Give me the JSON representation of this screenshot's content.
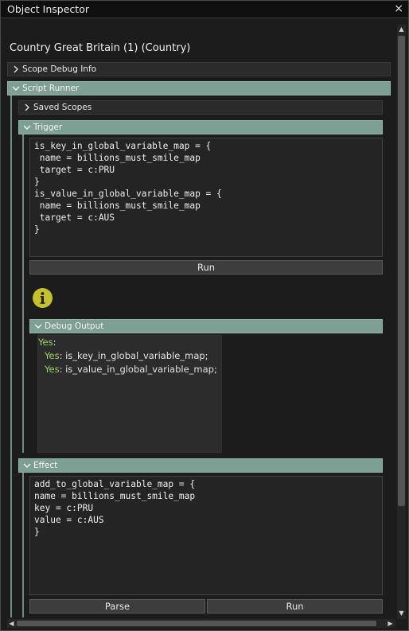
{
  "window": {
    "title": "Object Inspector",
    "close_glyph": "×"
  },
  "object_name": "Country Great Britain (1) (Country)",
  "sections": {
    "scope_debug_info": "Scope Debug Info",
    "script_runner": "Script Runner",
    "saved_scopes": "Saved Scopes",
    "trigger": "Trigger",
    "debug_output": "Debug Output",
    "effect": "Effect"
  },
  "trigger_script": "is_key_in_global_variable_map = {\n name = billions_must_smile_map\n target = c:PRU\n}\nis_value_in_global_variable_map = {\n name = billions_must_smile_map\n target = c:AUS\n}",
  "trigger_run_label": "Run",
  "debug_output": {
    "root_yes": "Yes",
    "root_colon": ":",
    "lines": [
      {
        "yes": "Yes",
        "text": ": is_key_in_global_variable_map;"
      },
      {
        "yes": "Yes",
        "text": ": is_value_in_global_variable_map;"
      }
    ]
  },
  "effect_script": "add_to_global_variable_map = {\nname = billions_must_smile_map\nkey = c:PRU\nvalue = c:AUS\n}",
  "effect_parse_label": "Parse",
  "effect_run_label": "Run",
  "icons": [
    "close-icon",
    "chevron-right-icon",
    "chevron-down-icon",
    "info-icon",
    "scroll-arrow-icons"
  ],
  "colors": {
    "section_open": "#7e9f94",
    "yes_green": "#9bd36e",
    "info_yellow": "#c4c12b"
  }
}
